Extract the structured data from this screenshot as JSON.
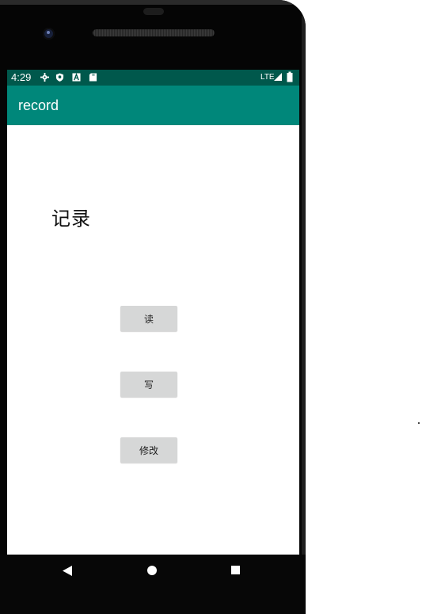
{
  "status_bar": {
    "time": "4:29",
    "network": "LTE",
    "icons": [
      "settings-icon",
      "shield-icon",
      "a-icon",
      "sd-card-icon",
      "signal-icon",
      "battery-icon"
    ]
  },
  "app_bar": {
    "title": "record"
  },
  "main": {
    "heading": "记录",
    "buttons": {
      "read": "读",
      "write": "写",
      "edit": "修改"
    }
  },
  "navigation": {
    "icons": [
      "back-icon",
      "home-icon",
      "recent-apps-icon"
    ]
  },
  "colors": {
    "status_bar": "#00584c",
    "app_bar": "#00877a",
    "button": "#d6d7d7",
    "device_frame": "#050505",
    "screen": "#ffffff"
  }
}
